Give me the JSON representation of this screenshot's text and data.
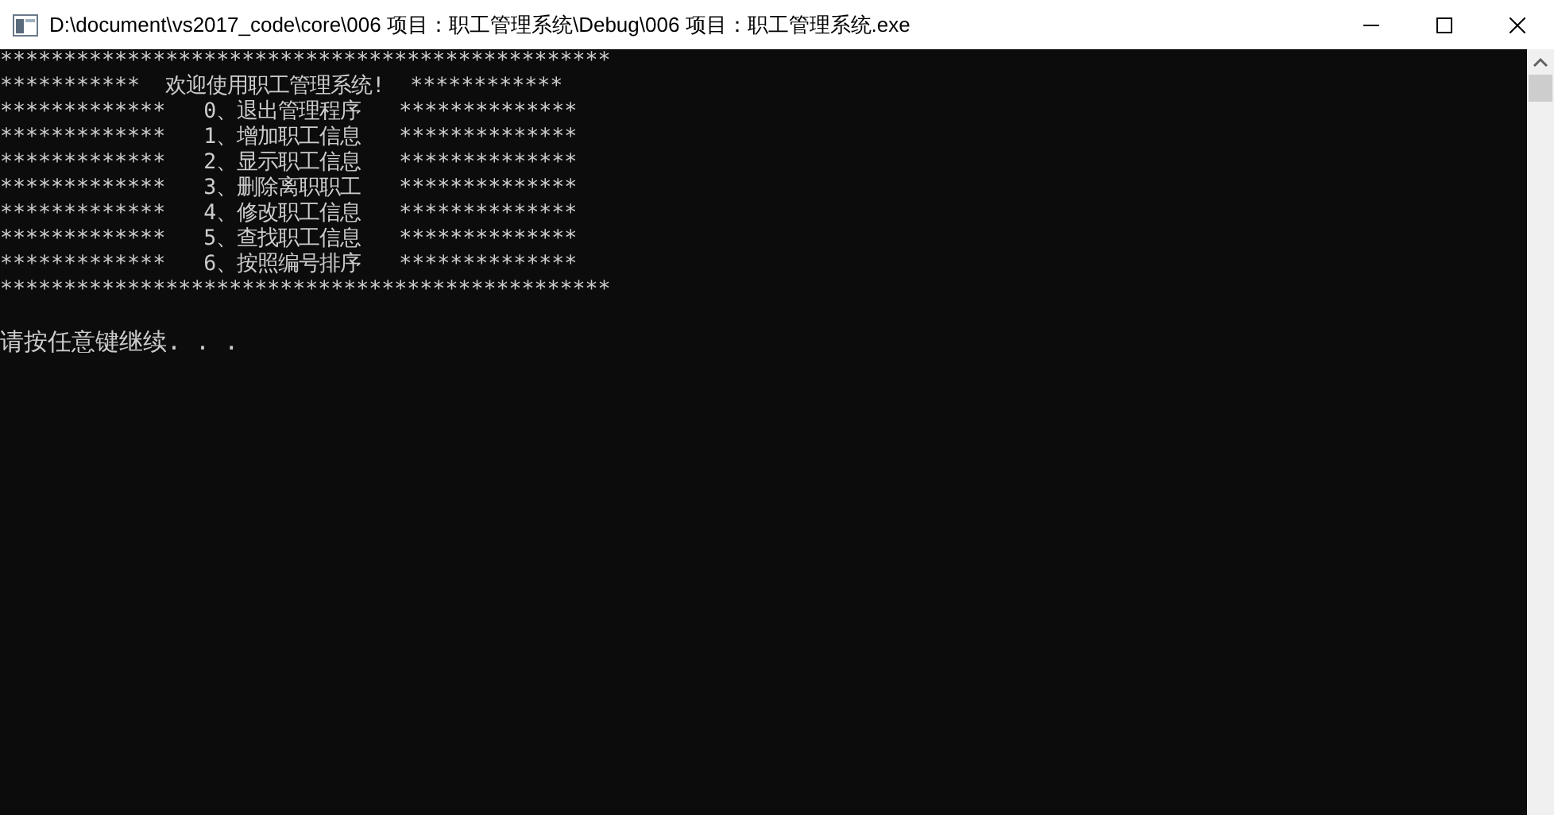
{
  "window": {
    "title": "D:\\document\\vs2017_code\\core\\006 项目：职工管理系统\\Debug\\006 项目：职工管理系统.exe"
  },
  "console": {
    "lines": [
      "************************************************",
      "***********  欢迎使用职工管理系统!  ************",
      "*************   0、退出管理程序   **************",
      "*************   1、增加职工信息   **************",
      "*************   2、显示职工信息   **************",
      "*************   3、删除离职职工   **************",
      "*************   4、修改职工信息   **************",
      "*************   5、查找职工信息   **************",
      "*************   6、按照编号排序   **************",
      "************************************************"
    ],
    "prompt": "请按任意键继续. . ."
  }
}
